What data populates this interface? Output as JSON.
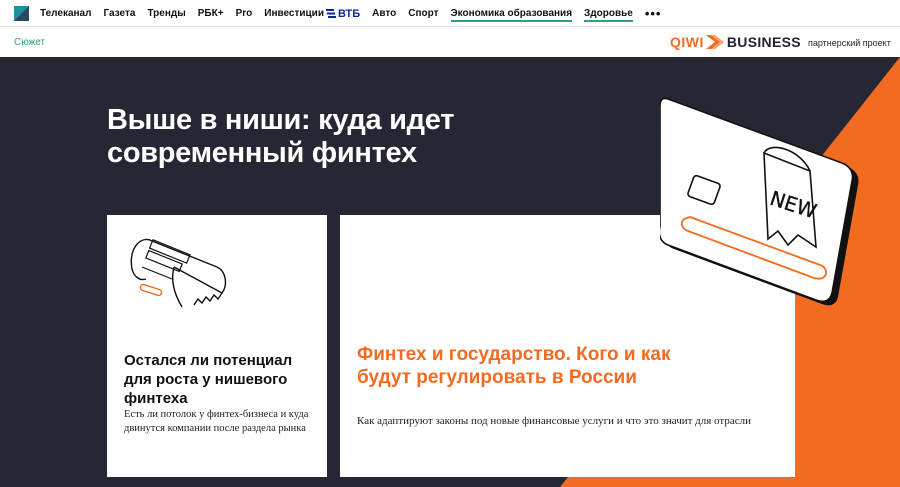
{
  "topnav": {
    "items": [
      {
        "label": "Телеканал",
        "underline": false
      },
      {
        "label": "Газета",
        "underline": false
      },
      {
        "label": "Тренды",
        "underline": false
      },
      {
        "label": "РБК+",
        "underline": false
      },
      {
        "label": "Pro",
        "underline": false
      },
      {
        "label": "Инвестиции",
        "underline": false
      },
      {
        "label": "Авто",
        "underline": false
      },
      {
        "label": "Спорт",
        "underline": false
      },
      {
        "label": "Экономика образования",
        "underline": true
      },
      {
        "label": "Здоровье",
        "underline": true
      }
    ],
    "vtb_label": "ВТБ",
    "more_label": "•••"
  },
  "subbar": {
    "section_label": "Сюжет",
    "brand_primary": "QIWI",
    "brand_secondary": "BUSINESS",
    "partner_label": "партнерский проект"
  },
  "hero": {
    "title": "Выше в ниши: куда идет современный финтех",
    "card_left": {
      "title": "Остался ли потенциал для роста у нишевого финтеха",
      "description": "Есть ли потолок у финтех-бизнеса и куда двинутся компании после раздела рынка"
    },
    "card_main": {
      "title": "Финтех и государство. Кого и как будут регулировать в России",
      "description": "Как адаптируют законы под новые финансовые услуги и что это значит для отрасли"
    },
    "card_badge": "NEW"
  },
  "colors": {
    "accent_green": "#2fa37a",
    "accent_orange": "#f26b21",
    "hero_dark": "#262734"
  }
}
